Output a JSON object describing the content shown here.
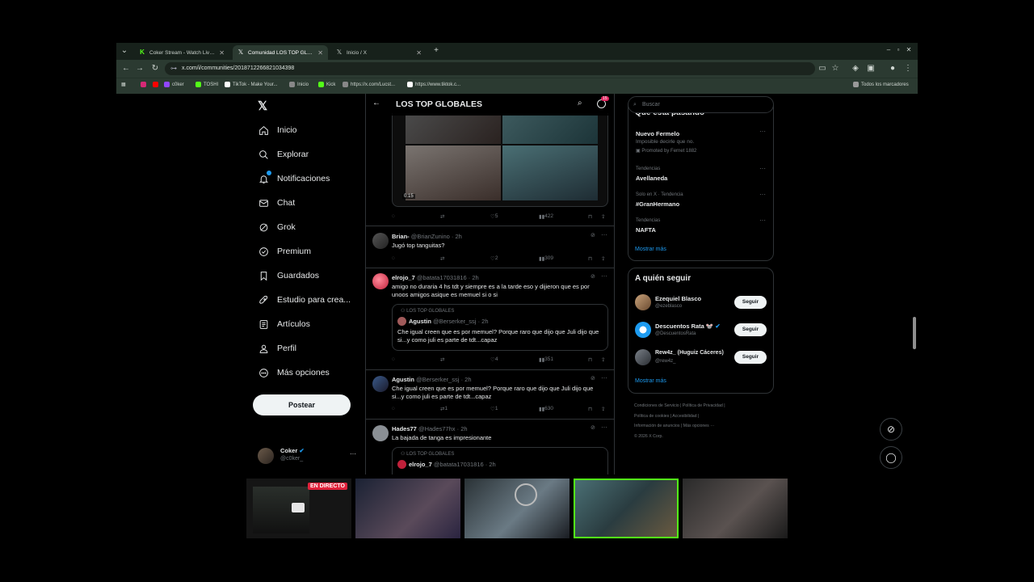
{
  "browser": {
    "tabs": [
      {
        "title": "Coker Stream - Watch Live on K",
        "icon": "kick-logo-icon"
      },
      {
        "title": "Comunidad LOS TOP GLOBALES",
        "icon": "x-logo-icon"
      },
      {
        "title": "Inicio / X",
        "icon": "x-logo-icon"
      }
    ],
    "url": "x.com/i/communities/2018712266821034398",
    "bookmarks": [
      "c0ker",
      "TOSHI",
      "TikTok - Make Your...",
      "Inicio",
      "Kick",
      "https://x.com/Lucst...",
      "https://www.tiktok.c..."
    ],
    "all_bookmarks": "Todos los marcadores"
  },
  "sidebar": {
    "items": [
      {
        "label": "Inicio",
        "icon": "home-icon"
      },
      {
        "label": "Explorar",
        "icon": "search-icon"
      },
      {
        "label": "Notificaciones",
        "icon": "bell-icon"
      },
      {
        "label": "Chat",
        "icon": "mail-icon"
      },
      {
        "label": "Grok",
        "icon": "grok-icon"
      },
      {
        "label": "Premium",
        "icon": "premium-icon"
      },
      {
        "label": "Guardados",
        "icon": "bookmark-icon"
      },
      {
        "label": "Estudio para crea...",
        "icon": "rocket-icon"
      },
      {
        "label": "Artículos",
        "icon": "article-icon"
      },
      {
        "label": "Perfil",
        "icon": "person-icon"
      },
      {
        "label": "Más opciones",
        "icon": "more-circle-icon"
      }
    ],
    "post_label": "Postear",
    "account": {
      "name": "Coker",
      "handle": "@c0ker_"
    }
  },
  "feed": {
    "title": "LOS TOP GLOBALES",
    "notif_count": "15",
    "video": {
      "time": "0:15",
      "likes": "5",
      "views": "422"
    },
    "posts": [
      {
        "name": "Brian-",
        "handle": "@BrianZunino",
        "time": "· 2h",
        "text": "Jugó top tanguitas?",
        "replies": "",
        "reposts": "",
        "likes": "2",
        "views": "309"
      },
      {
        "name": "elrojo_7",
        "handle": "@batata17031816",
        "time": "· 2h",
        "text": "amigo no duraria 4 hs tdt y siempre es a la tarde eso y dijieron que es por unoos amigos asique es memuel si o si",
        "replies": "",
        "reposts": "",
        "likes": "4",
        "views": "351",
        "quote": {
          "community": "LOS TOP GLOBALES",
          "name": "Agustin",
          "handle": "@Berserker_ssj",
          "time": "· 2h",
          "text": "Che igual creen que es por memuel? Porque raro que dijo que Juli dijo que si...y como juli es parte de tdt...capaz"
        }
      },
      {
        "name": "Agustin",
        "handle": "@Berserker_ssj",
        "time": "· 2h",
        "text": "Che igual creen que es por memuel? Porque raro que dijo que Juli dijo que si...y como juli es parte de tdt...capaz",
        "replies": "",
        "reposts": "1",
        "likes": "1",
        "views": "630"
      },
      {
        "name": "Hades77",
        "handle": "@Hades77hx",
        "time": "· 2h",
        "text": "La bajada de tanga es impresionante",
        "quote": {
          "community": "LOS TOP GLOBALES",
          "name": "elrojo_7",
          "handle": "@batata17031816",
          "time": "· 2h"
        }
      }
    ]
  },
  "right": {
    "search_placeholder": "Buscar",
    "trends_title": "Qué está pasando",
    "trends": [
      {
        "meta": "",
        "title": "Nuevo Fermelo",
        "sub": "Imposible decirle que no.",
        "promo": "Promoted by Fernet 1882"
      },
      {
        "meta": "Tendencias",
        "title": "Avellaneda"
      },
      {
        "meta": "Solo en X · Tendencia",
        "title": "#GranHermano"
      },
      {
        "meta": "Tendencias",
        "title": "NAFTA"
      }
    ],
    "show_more": "Mostrar más",
    "wtf_title": "A quién seguir",
    "who_to_follow": [
      {
        "name": "Ezequiel Blasco",
        "handle": "@ezeblasco"
      },
      {
        "name": "Descuentos Rata 🐭",
        "handle": "@DescuentosRata"
      },
      {
        "name": "Rew4z_ (Huguiz Cáceres)",
        "handle": "@rew4z_"
      }
    ],
    "follow_label": "Seguir",
    "footer": [
      "Condiciones de Servicio",
      "Política de Privacidad",
      "Política de cookies",
      "Accesibilidad",
      "Información de anuncios",
      "Más opciones ···",
      "© 2026 X Corp."
    ]
  },
  "stream": {
    "live_label": "EN DIRECTO"
  },
  "colors": {
    "accent": "#1d9bf0",
    "browser_frame": "#1f2a23",
    "live": "#e0213b"
  }
}
